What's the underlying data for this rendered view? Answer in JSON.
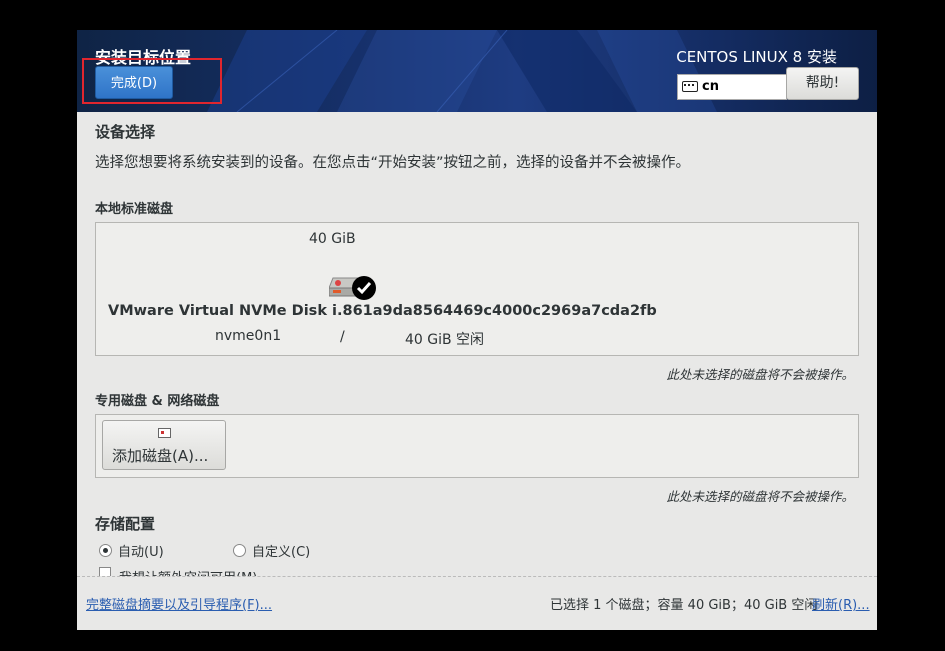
{
  "header": {
    "spoke_title": "安装目标位置",
    "done_button": "完成(D)",
    "product_title": "CENTOS LINUX 8 安装",
    "keyboard_layout": "cn",
    "help_button": "帮助!"
  },
  "device_selection": {
    "heading": "设备选择",
    "description": "选择您想要将系统安装到的设备。在您点击“开始安装”按钮之前，选择的设备并不会被操作。"
  },
  "local_disks": {
    "heading": "本地标准磁盘",
    "disk": {
      "size": "40 GiB",
      "name": "VMware Virtual NVMe Disk i.861a9da8564469c4000c2969a7cda2fb",
      "device": "nvme0n1",
      "separator": "/",
      "free": "40 GiB 空闲",
      "selected": true
    },
    "note": "此处未选择的磁盘将不会被操作。"
  },
  "specialized_disks": {
    "heading": "专用磁盘 & 网络磁盘",
    "add_button": "添加磁盘(A)...",
    "note": "此处未选择的磁盘将不会被操作。"
  },
  "storage_config": {
    "heading": "存储配置",
    "options": [
      {
        "label": "自动(U)",
        "selected": true
      },
      {
        "label": "自定义(C)",
        "selected": false
      }
    ],
    "extra_space_checkbox": "我想让额外空间可用(M)"
  },
  "footer": {
    "summary_link": "完整磁盘摘要以及引导程序(F)...",
    "status": "已选择 1 个磁盘；容量 40 GiB；40 GiB 空闲",
    "refresh_link": "刷新(R)..."
  }
}
